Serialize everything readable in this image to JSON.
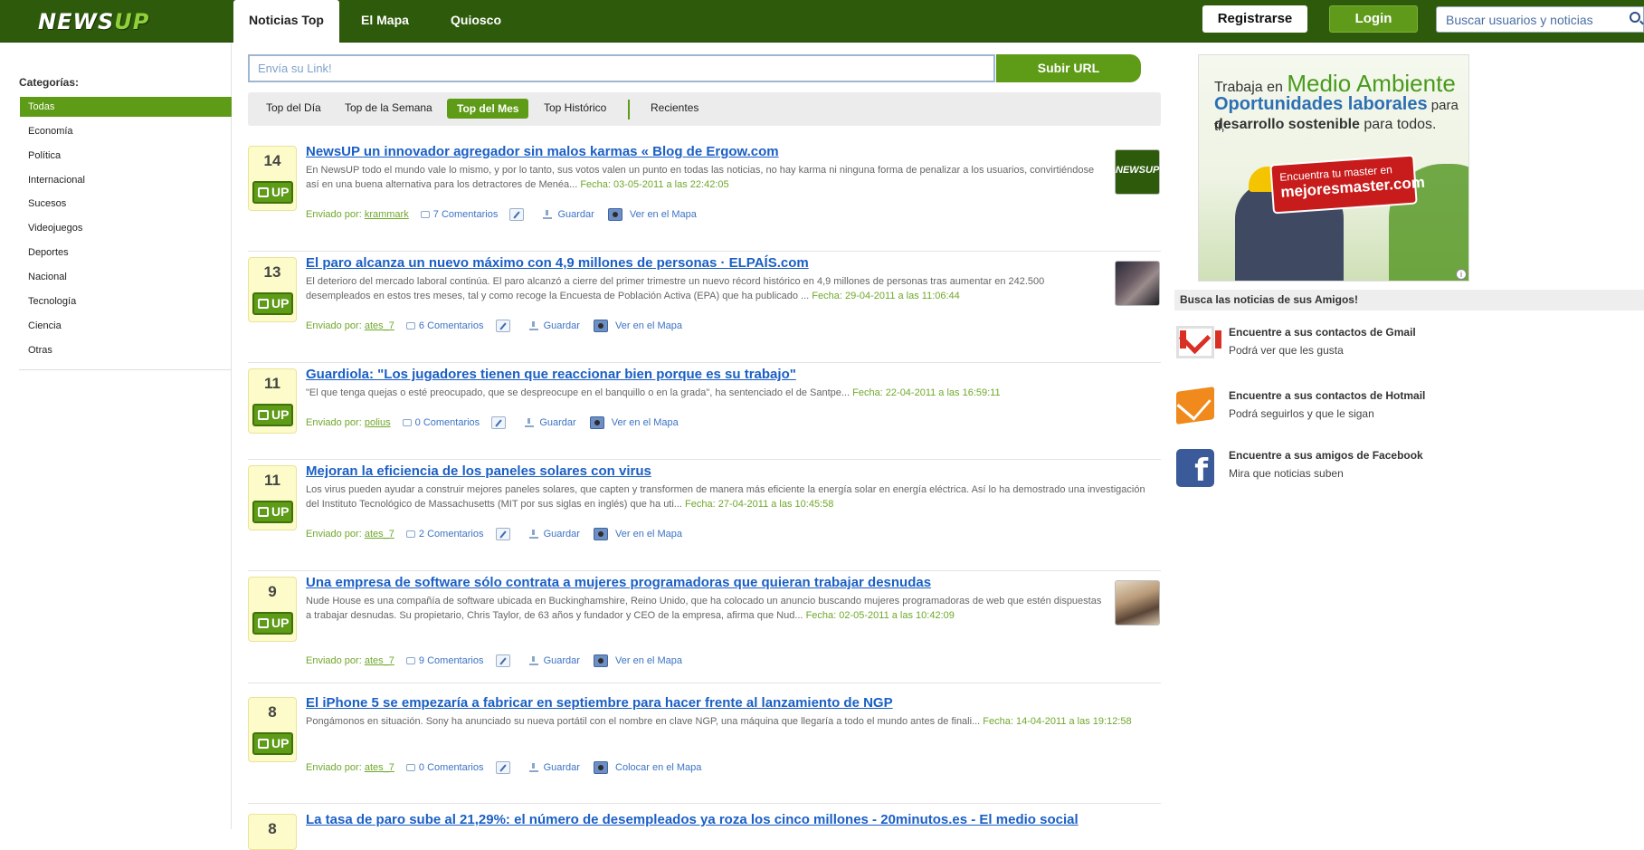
{
  "header": {
    "logo": {
      "part1": "NEWS",
      "part2": "UP"
    },
    "nav": [
      "Noticias Top",
      "El Mapa",
      "Quiosco"
    ],
    "register_label": "Registrarse",
    "login_label": "Login",
    "search_placeholder": "Buscar usuarios y noticias"
  },
  "sidebar": {
    "title": "Categorías:",
    "items": [
      "Todas",
      "Economía",
      "Política",
      "Internacional",
      "Sucesos",
      "Videojuegos",
      "Deportes",
      "Nacional",
      "Tecnología",
      "Ciencia",
      "Otras"
    ],
    "active_index": 0
  },
  "submit": {
    "placeholder": "Envía su Link!",
    "button_label": "Subir URL"
  },
  "filters": {
    "tabs": [
      "Top del Día",
      "Top de la Semana",
      "Top del Mes",
      "Top Histórico",
      "Recientes"
    ],
    "active_index": 2
  },
  "labels": {
    "sent_by": "Enviado por:",
    "vote": "UP",
    "save": "Guardar"
  },
  "news": [
    {
      "votes": "14",
      "title": "NewsUP un innovador agregador sin malos karmas « Blog de Ergow.com",
      "desc": "En NewsUP todo el mundo vale lo mismo, y por lo tanto, sus votos valen un punto en todas las noticias, no hay karma ni ninguna forma de penalizar a los usuarios, convirtiéndose así en una buena alternativa para los detractores de Menéa...",
      "date": "Fecha: 03-05-2011 a las 22:42:05",
      "user": "krammark",
      "comments": "7 Comentarios",
      "map": "Ver en el Mapa"
    },
    {
      "votes": "13",
      "title": "El paro alcanza un nuevo máximo con 4,9 millones de personas · ELPAÍS.com",
      "desc": "El deterioro del mercado laboral continúa. El paro alcanzó a cierre del primer trimestre un nuevo récord histórico en 4,9 millones de personas tras aumentar en 242.500 desempleados en estos tres meses, tal y como recoge la Encuesta de Población Activa (EPA) que ha publicado ...",
      "date": "Fecha: 29-04-2011 a las 11:06:44",
      "user": "ates_7",
      "comments": "6 Comentarios",
      "map": "Ver en el Mapa"
    },
    {
      "votes": "11",
      "title": "Guardiola: \"Los jugadores tienen que reaccionar bien porque es su trabajo\"",
      "desc": "\"El que tenga quejas o esté preocupado, que se despreocupe en el banquillo o en la grada\", ha sentenciado el de Santpe...",
      "date": "Fecha: 22-04-2011 a las 16:59:11",
      "user": "polius",
      "comments": "0 Comentarios",
      "map": "Ver en el Mapa"
    },
    {
      "votes": "11",
      "title": "Mejoran la eficiencia de los paneles solares con virus",
      "desc": "Los virus pueden ayudar a construir mejores paneles solares, que capten y transformen de manera más eficiente la energía solar en energía eléctrica. Así lo ha demostrado una investigación del Instituto Tecnológico de Massachusetts (MIT por sus siglas en inglés) que ha uti...",
      "date": "Fecha: 27-04-2011 a las 10:45:58",
      "user": "ates_7",
      "comments": "2 Comentarios",
      "map": "Ver en el Mapa"
    },
    {
      "votes": "9",
      "title": "Una empresa de software sólo contrata a mujeres programadoras que quieran trabajar desnudas",
      "desc": "Nude House es una compañía de software ubicada en Buckinghamshire, Reino Unido, que ha colocado un anuncio buscando mujeres programadoras de web que estén dispuestas a trabajar desnudas. Su propietario, Chris Taylor, de 63 años y fundador y CEO de la empresa, afirma que Nud...",
      "date": "Fecha: 02-05-2011 a las 10:42:09",
      "user": "ates_7",
      "comments": "9 Comentarios",
      "map": "Ver en el Mapa"
    },
    {
      "votes": "8",
      "title": "El iPhone 5 se empezaría a fabricar en septiembre para hacer frente al lanzamiento de NGP",
      "desc": "Pongámonos en situación. Sony ha anunciado su nueva portátil con el nombre en clave NGP, una máquina que llegaría a todo el mundo antes de finali...",
      "date": "Fecha: 14-04-2011 a las 19:12:58",
      "user": "ates_7",
      "comments": "0 Comentarios",
      "map": "Colocar en el Mapa"
    },
    {
      "votes": "8",
      "title": "La tasa de paro sube al 21,29%: el número de desempleados ya roza los cinco millones - 20minutos.es - El medio social"
    }
  ],
  "thumbs": {
    "logo_text": "NEWSUP"
  },
  "ad": {
    "line1a": "Trabaja en ",
    "line1b": "Medio Ambiente",
    "line2a": "Oportunidades laborales",
    "line2b": " para ti,",
    "line3a": "desarrollo sostenible",
    "line3b": " para todos.",
    "cta1": "Encuentra tu master en",
    "cta2": "mejoresmaster.com",
    "info": "i"
  },
  "friends": {
    "heading": "Busca las noticias de sus Amigos!",
    "items": [
      {
        "icon": "gmail-icon",
        "title": "Encuentre a sus contactos de Gmail",
        "sub": "Podrá ver que les gusta"
      },
      {
        "icon": "hotmail-icon",
        "title": "Encuentre a sus contactos de Hotmail",
        "sub": "Podrá seguirlos y que le sigan"
      },
      {
        "icon": "facebook-icon",
        "title": "Encuentre a sus amigos de Facebook",
        "sub": "Mira que noticias suben",
        "glyph": "f"
      }
    ]
  },
  "colors": {
    "brand_green": "#5e9b17",
    "header_green": "#2e5a0b",
    "link_blue": "#1a5fc5",
    "vote_bg": "#fdfbc9"
  }
}
